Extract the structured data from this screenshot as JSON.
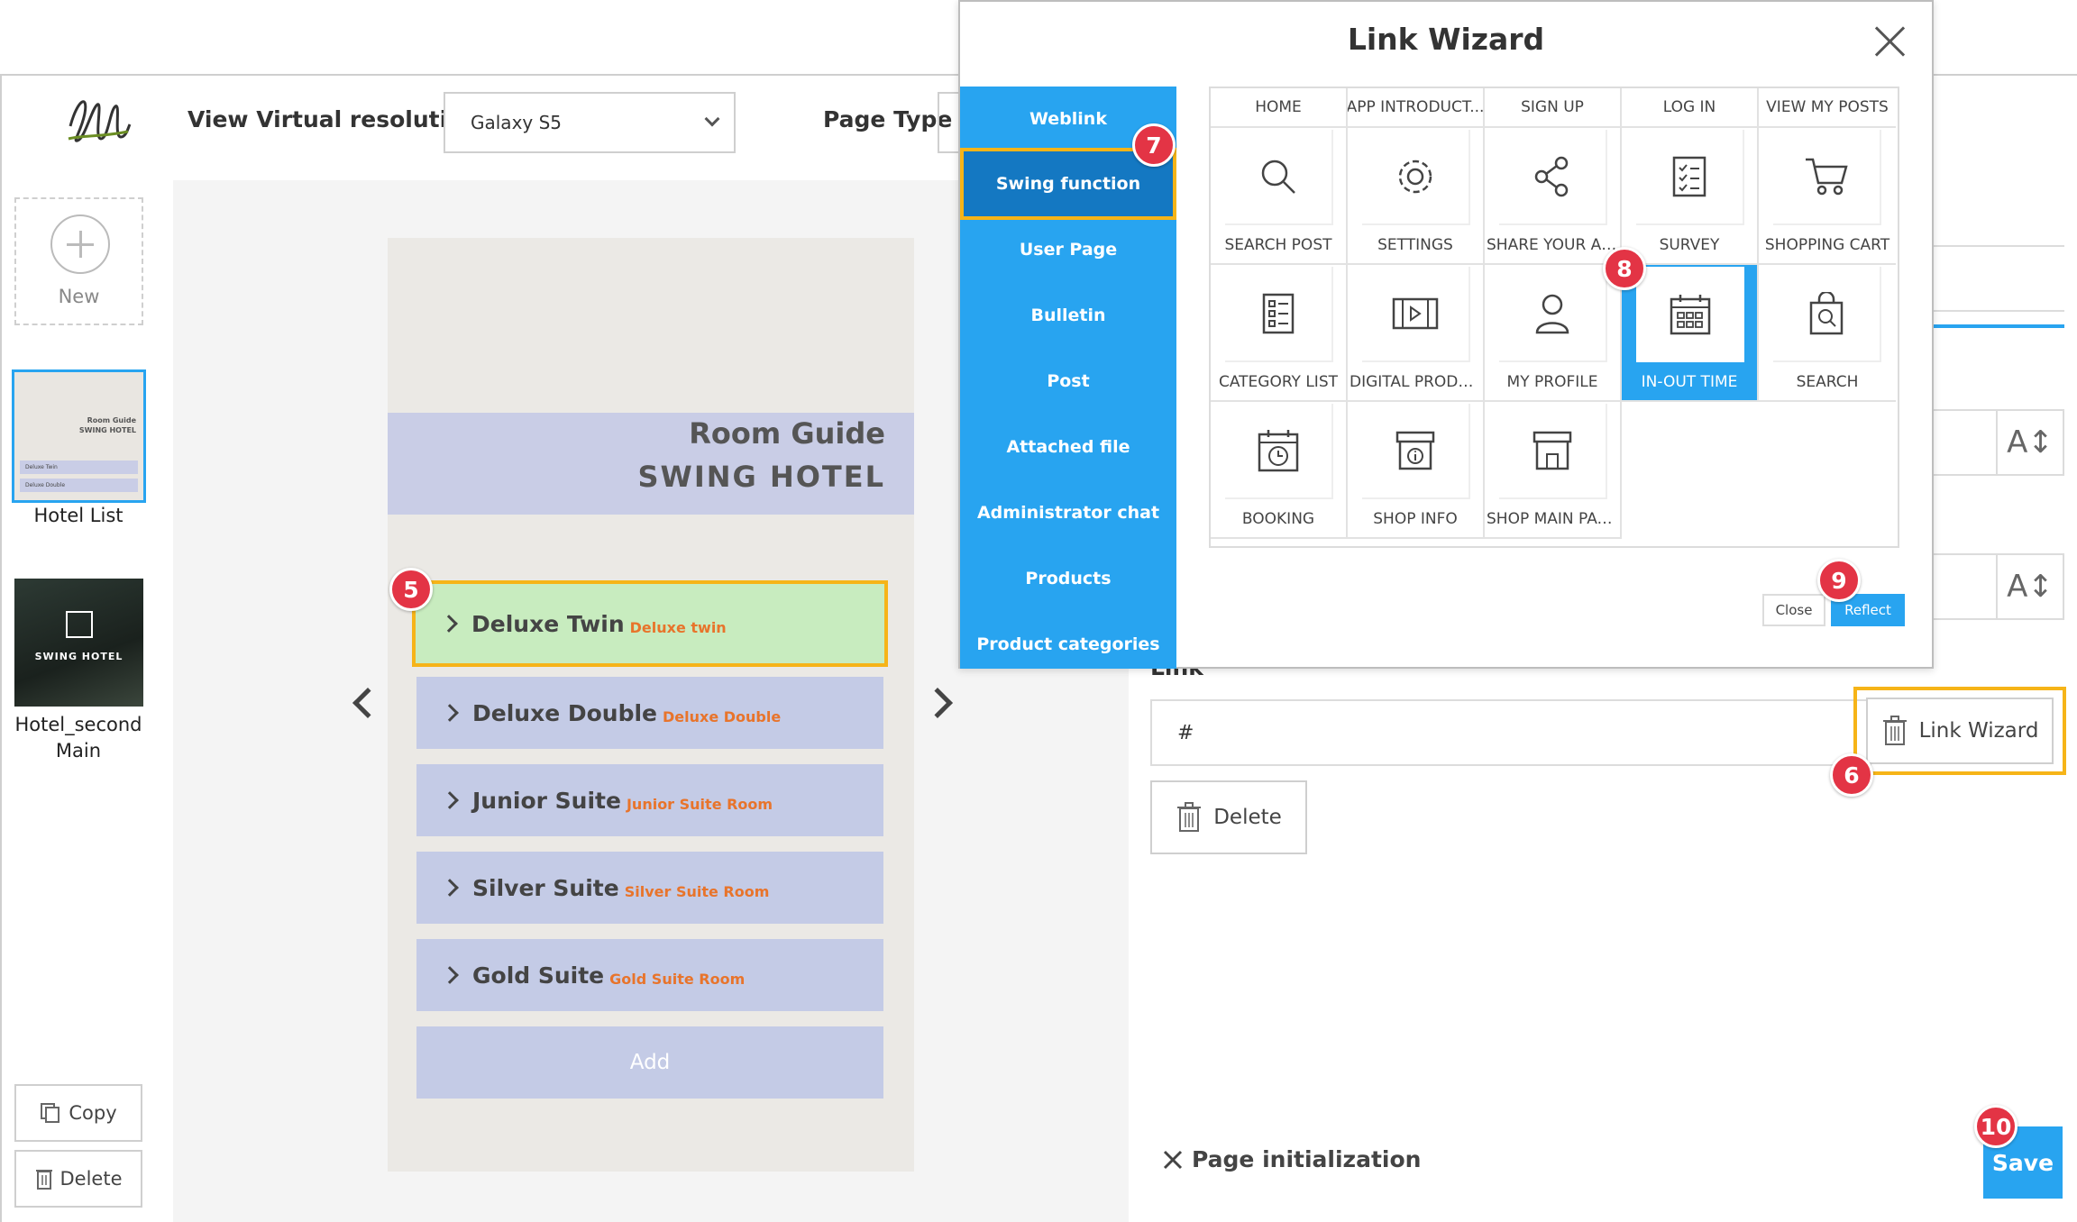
{
  "editor": {
    "view_resolution_label": "View Virtual resolution",
    "resolution_value": "Galaxy S5",
    "page_type_label": "Page Type"
  },
  "pages": {
    "new_label": "New",
    "items": [
      {
        "label": "Hotel List",
        "thumb_title": "Room Guide",
        "thumb_subtitle": "SWING HOTEL",
        "thumb_item1": "Deluxe Twin",
        "thumb_item2": "Deluxe Double"
      },
      {
        "label_line1": "Hotel_second",
        "label_line2": "Main",
        "thumb_text": "SWING HOTEL"
      }
    ],
    "copy_label": "Copy",
    "delete_label": "Delete"
  },
  "preview": {
    "title": "Room Guide",
    "subtitle": "SWING HOTEL",
    "rooms": [
      {
        "name": "Deluxe Twin",
        "sub": "Deluxe twin"
      },
      {
        "name": "Deluxe Double",
        "sub": "Deluxe Double"
      },
      {
        "name": "Junior Suite",
        "sub": "Junior Suite Room"
      },
      {
        "name": "Silver Suite",
        "sub": "Silver Suite Room"
      },
      {
        "name": "Gold Suite",
        "sub": "Gold Suite Room"
      }
    ],
    "add_label": "Add"
  },
  "properties": {
    "link_label": "Link",
    "link_value": "#",
    "link_wizard_label": "Link Wizard",
    "delete_label": "Delete",
    "page_init_label": "Page initialization",
    "save_label": "Save",
    "font_size_glyph": "A↕"
  },
  "modal": {
    "title": "Link Wizard",
    "menu": [
      "Weblink",
      "Swing function",
      "User Page",
      "Bulletin",
      "Post",
      "Attached file",
      "Administrator chat",
      "Products",
      "Product categories"
    ],
    "headers": [
      "HOME",
      "APP INTRODUCT...",
      "SIGN UP",
      "LOG IN",
      "VIEW MY POSTS"
    ],
    "row1": [
      "SEARCH POST",
      "SETTINGS",
      "SHARE YOUR APP",
      "SURVEY",
      "SHOPPING CART"
    ],
    "row2": [
      "CATEGORY LIST",
      "DIGITAL PRODUC...",
      "MY PROFILE",
      "IN-OUT TIME",
      "SEARCH"
    ],
    "row3": [
      "BOOKING",
      "SHOP INFO",
      "SHOP MAIN PAGE"
    ],
    "close_label": "Close",
    "reflect_label": "Reflect"
  },
  "badges": [
    "5",
    "6",
    "7",
    "8",
    "9",
    "10"
  ],
  "colors": {
    "accent": "#28a4f0",
    "highlight": "#f6b418",
    "badge": "#e33445",
    "sub_text": "#e8742b"
  }
}
